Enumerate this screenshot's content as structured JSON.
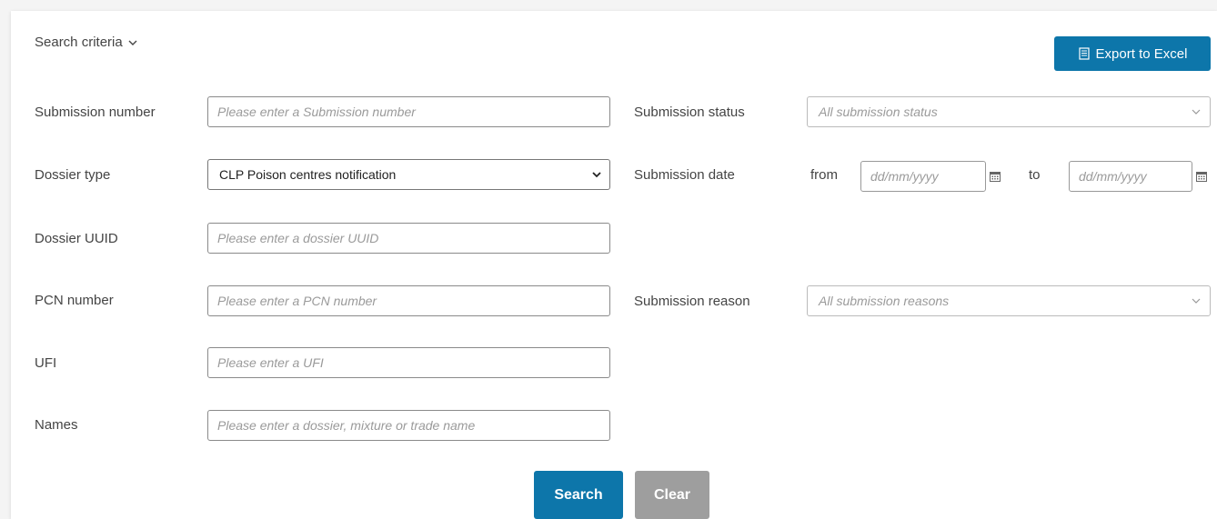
{
  "header": {
    "criteria_label": "Search criteria",
    "export_label": "Export to Excel"
  },
  "left_fields": [
    {
      "label": "Submission number",
      "placeholder": "Please enter a Submission number"
    },
    {
      "label": "Dossier type",
      "value": "CLP Poison centres notification"
    },
    {
      "label": "Dossier UUID",
      "placeholder": "Please enter a dossier UUID"
    },
    {
      "label": "PCN number",
      "placeholder": "Please enter a PCN number"
    },
    {
      "label": "UFI",
      "placeholder": "Please enter a UFI"
    },
    {
      "label": "Names",
      "placeholder": "Please enter a dossier, mixture or trade name"
    }
  ],
  "right_fields": {
    "status": {
      "label": "Submission status",
      "value": "All submission status"
    },
    "date": {
      "label": "Submission date",
      "from_label": "from",
      "to_label": "to",
      "from_placeholder": "dd/mm/yyyy",
      "to_placeholder": "dd/mm/yyyy"
    },
    "reason": {
      "label": "Submission reason",
      "value": "All submission reasons"
    }
  },
  "actions": {
    "search_label": "Search",
    "clear_label": "Clear"
  },
  "colors": {
    "primary": "#0d76aa",
    "secondary": "#9e9e9e"
  }
}
